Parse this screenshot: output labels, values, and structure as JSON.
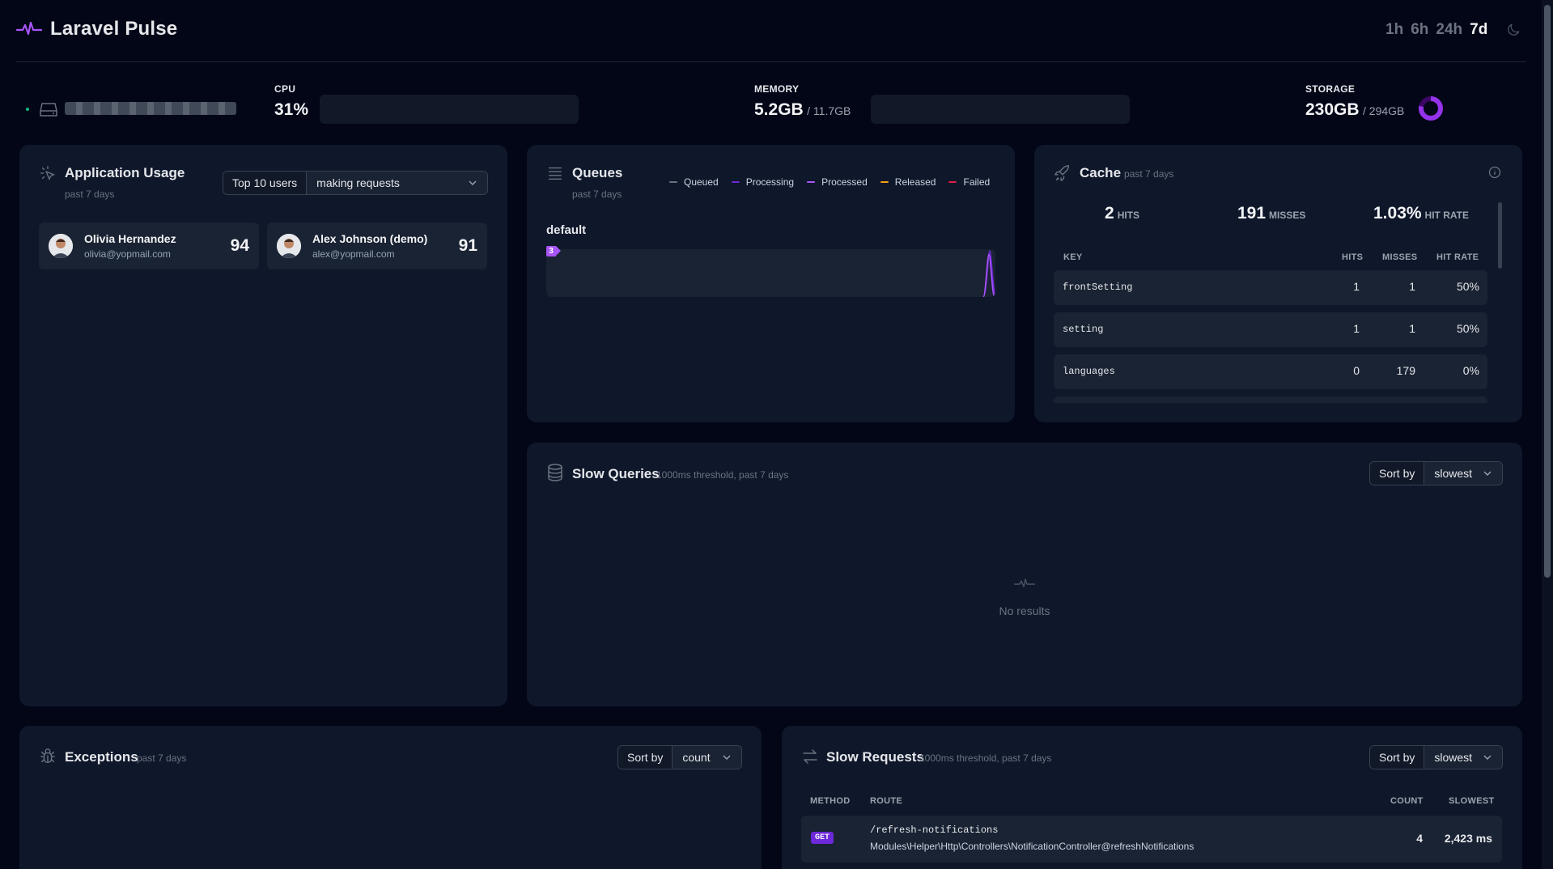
{
  "app": {
    "title": "Laravel Pulse"
  },
  "periods": [
    "1h",
    "6h",
    "24h",
    "7d"
  ],
  "active_period": "7d",
  "server": {
    "cpu": {
      "label": "CPU",
      "value": "31%",
      "percent": 31
    },
    "memory": {
      "label": "MEMORY",
      "value": "5.2GB",
      "total": "/ 11.7GB",
      "percent": 44
    },
    "storage": {
      "label": "STORAGE",
      "value": "230GB",
      "total": "/ 294GB",
      "percent": 78
    }
  },
  "usage": {
    "title": "Application Usage",
    "subtitle": "past 7 days",
    "filter_label": "Top 10 users",
    "filter_value": "making requests",
    "users": [
      {
        "name": "Olivia Hernandez",
        "email": "olivia@yopmail.com",
        "count": "94"
      },
      {
        "name": "Alex Johnson (demo)",
        "email": "alex@yopmail.com",
        "count": "91"
      }
    ]
  },
  "queues": {
    "title": "Queues",
    "subtitle": "past 7 days",
    "legend": [
      {
        "label": "Queued",
        "color": "#6b7280"
      },
      {
        "label": "Processing",
        "color": "#6d28d9"
      },
      {
        "label": "Processed",
        "color": "#a855f7"
      },
      {
        "label": "Released",
        "color": "#f59e0b"
      },
      {
        "label": "Failed",
        "color": "#e11d48"
      }
    ],
    "queue_name": "default",
    "badge": "3"
  },
  "cache": {
    "title": "Cache",
    "subtitle": "past 7 days",
    "hits": "2",
    "hits_label": "HITS",
    "misses": "191",
    "misses_label": "MISSES",
    "hit_rate": "1.03%",
    "hit_rate_label": "HIT RATE",
    "columns": {
      "key": "KEY",
      "hits": "HITS",
      "misses": "MISSES",
      "rate": "HIT RATE"
    },
    "rows": [
      {
        "key": "frontSetting",
        "hits": "1",
        "misses": "1",
        "rate": "50%"
      },
      {
        "key": "setting",
        "hits": "1",
        "misses": "1",
        "rate": "50%"
      },
      {
        "key": "languages",
        "hits": "0",
        "misses": "179",
        "rate": "0%"
      }
    ]
  },
  "slow_queries": {
    "title": "Slow Queries",
    "subtitle": "1000ms threshold, past 7 days",
    "sort_label": "Sort by",
    "sort_value": "slowest",
    "empty": "No results"
  },
  "exceptions": {
    "title": "Exceptions",
    "subtitle": "past 7 days",
    "sort_label": "Sort by",
    "sort_value": "count"
  },
  "slow_requests": {
    "title": "Slow Requests",
    "subtitle": "1000ms threshold, past 7 days",
    "sort_label": "Sort by",
    "sort_value": "slowest",
    "columns": {
      "method": "METHOD",
      "route": "ROUTE",
      "count": "COUNT",
      "slowest": "SLOWEST"
    },
    "rows": [
      {
        "method": "GET",
        "route": "/refresh-notifications",
        "action": "Modules\\Helper\\Http\\Controllers\\NotificationController@refreshNotifications",
        "count": "4",
        "slowest": "2,423 ms"
      }
    ]
  }
}
